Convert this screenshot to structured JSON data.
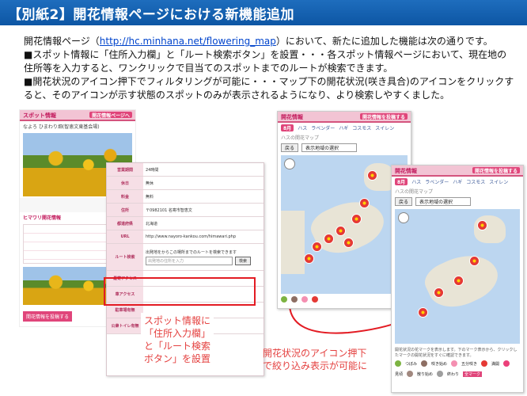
{
  "title": "【別紙2】開花情報ページにおける新機能追加",
  "description": {
    "intro_before": "開花情報ページ（",
    "intro_link": "http://hc.minhana.net/flowering_map",
    "intro_after": "）において、新たに追加した機能は次の通りです。",
    "point1": "■スポット情報に「住所入力欄」と「ルート検索ボタン」を設置・・・各スポット情報ページにおいて、現在地の住所等を入力すると、ワンクリックで目当てのスポットまでのルートが検索できます。",
    "point2": "■開花状況のアイコン押下でフィルタリングが可能に・・・マップ下の開花状況(咲き具合)のアイコンをクリックすると、そのアイコンが示す状態のスポットのみが表示されるようになり、より検索しやすくました。"
  },
  "left_shot": {
    "header": "スポット情報",
    "header_btn": "開花情報ページへ",
    "spot_name": "なよろ ひまわり畑(智恵文東基会場)",
    "tab1": "ヒマワリ開花情報",
    "post_btn": "開花情報を投稿する"
  },
  "form": {
    "rows": [
      {
        "k": "営業期間",
        "v": "24時間"
      },
      {
        "k": "休日",
        "v": "無休"
      },
      {
        "k": "料金",
        "v": "無料"
      },
      {
        "k": "住所",
        "v": "〒0982101 名寄市智恵文"
      },
      {
        "k": "都道府県",
        "v": "北海道"
      },
      {
        "k": "URL",
        "v": "http://www.nayoro-kankou.com/himawari.php"
      }
    ],
    "route_label": "ルート検索",
    "route_hint": "出発地をからこの場所までのルートを検索できます",
    "route_placeholder": "出発地の住所を入力",
    "route_button": "検索",
    "rows_after": [
      {
        "k": "最寄アクセス",
        "v": ""
      },
      {
        "k": "車アクセス",
        "v": ""
      },
      {
        "k": "駐車場有無",
        "v": ""
      },
      {
        "k": "公衆トイレ有無",
        "v": ""
      }
    ]
  },
  "callout_left": [
    "スポット情報に",
    "「住所入力欄」",
    "と「ルート検索",
    "ボタン」を設置"
  ],
  "callout_right": [
    "開花状況のアイコン押下",
    "で絞り込み表示が可能に"
  ],
  "shot_top": {
    "header": "開花情報",
    "header_btn": "開花情報を投稿する",
    "month": "8月",
    "sub_label": "ハス",
    "tabs": [
      "ラベンダー",
      "ハギ",
      "コスモス",
      "スイレン"
    ],
    "map_label": "ハスの開花マップ",
    "ctrl_btn": "戻る",
    "select": "表示地域の選択"
  },
  "shot_bottom": {
    "header": "開花情報",
    "header_btn": "開花情報を投稿する",
    "month": "8月",
    "sub_label": "ハス",
    "tabs": [
      "ラベンダー",
      "ハギ",
      "コスモス",
      "スイレン"
    ],
    "map_label": "ハスの開花マップ",
    "ctrl_btn": "戻る",
    "select": "表示地域の選択",
    "legend": "開花状況の花マークを表示します。下のマーク表示から、クリックしたマークの開花状況をすぐに確認できます。",
    "legend_items": [
      "つぼみ",
      "咲き始め",
      "五分咲き",
      "満開",
      "見頃",
      "散り始め",
      "終わり",
      "全マーク"
    ]
  },
  "colors": {
    "title_bg": "#0d56a4",
    "accent_pink": "#e0457a",
    "highlight_red": "#e31b23",
    "callout_red": "#e4403f"
  }
}
